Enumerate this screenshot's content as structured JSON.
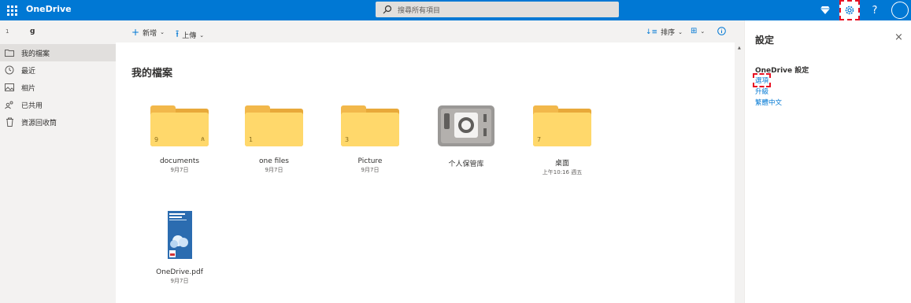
{
  "topbar": {
    "brand": "OneDrive",
    "search_placeholder": "搜尋所有項目",
    "help_label": "?"
  },
  "sidebar": {
    "user_index": "1",
    "user_name": "g",
    "items": [
      {
        "label": "我的檔案",
        "icon": "folder-icon"
      },
      {
        "label": "最近",
        "icon": "clock-icon"
      },
      {
        "label": "相片",
        "icon": "photo-icon"
      },
      {
        "label": "已共用",
        "icon": "shared-icon"
      },
      {
        "label": "資源回收筒",
        "icon": "recycle-bin-icon"
      }
    ]
  },
  "commands": {
    "new_label": "新增",
    "upload_label": "上傳",
    "sort_label": "排序"
  },
  "main": {
    "title": "我的檔案",
    "items": [
      {
        "name": "documents",
        "date": "9月7日",
        "count": "9",
        "shared": true,
        "type": "folder"
      },
      {
        "name": "one files",
        "date": "9月7日",
        "count": "1",
        "shared": false,
        "type": "folder"
      },
      {
        "name": "Picture",
        "date": "9月7日",
        "count": "3",
        "shared": false,
        "type": "folder"
      },
      {
        "name": "个人保管库",
        "date": "",
        "count": "",
        "shared": false,
        "type": "vault"
      },
      {
        "name": "桌面",
        "date": "上午10:16 週五",
        "count": "7",
        "shared": false,
        "type": "folder"
      },
      {
        "name": "OneDrive.pdf",
        "date": "9月7日",
        "count": "",
        "shared": false,
        "type": "pdf"
      }
    ]
  },
  "panel": {
    "title": "設定",
    "section_title": "OneDrive 設定",
    "links": [
      "選項",
      "升級",
      "繁體中文"
    ],
    "close_glyph": "×"
  },
  "colors": {
    "accent": "#0078d4",
    "folder": "#ffd86b",
    "highlight": "#e81123"
  }
}
